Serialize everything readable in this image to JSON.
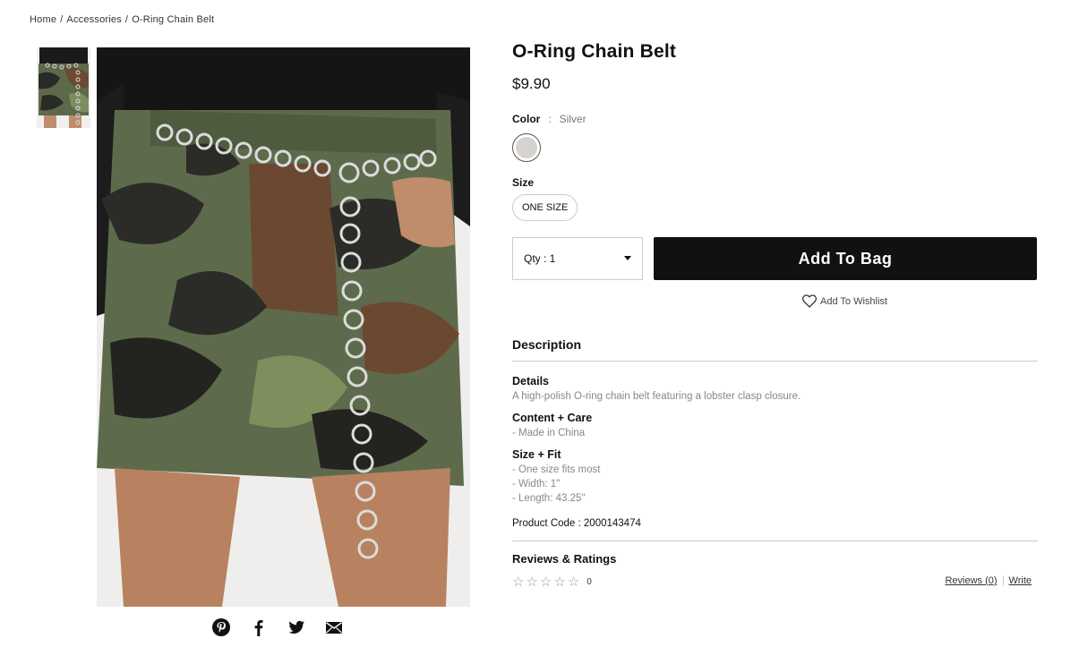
{
  "breadcrumb": {
    "home": "Home",
    "category": "Accessories",
    "current": "O-Ring Chain Belt",
    "separator": "/"
  },
  "product": {
    "title": "O-Ring Chain Belt",
    "price": "$9.90",
    "color_label": "Color",
    "color_sep": ":",
    "color_value": "Silver",
    "swatch_color": "#d6d3cf",
    "size_label": "Size",
    "size_option": "ONE SIZE",
    "qty_label": "Qty : 1",
    "add_to_bag": "Add To Bag",
    "wishlist": "Add To Wishlist"
  },
  "description": {
    "heading": "Description",
    "sections": [
      {
        "title": "Details",
        "lines": [
          "A high-polish O-ring chain belt featuring a lobster clasp closure."
        ]
      },
      {
        "title": "Content + Care",
        "lines": [
          "- Made in China"
        ]
      },
      {
        "title": "Size + Fit",
        "lines": [
          "- One size fits most",
          "- Width: 1\"",
          "- Length: 43.25\""
        ]
      }
    ],
    "product_code": "Product Code : 2000143474"
  },
  "reviews": {
    "heading": "Reviews & Ratings",
    "rating": 0,
    "count": "0",
    "reviews_link": "Reviews (0)",
    "write_link": "Write"
  },
  "share_icons": [
    "pinterest-icon",
    "facebook-icon",
    "twitter-icon",
    "email-icon"
  ]
}
